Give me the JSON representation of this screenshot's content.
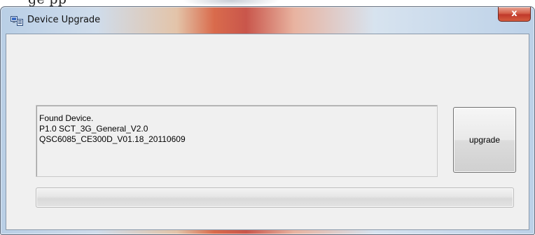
{
  "partial_top_text": "ge                                    pp",
  "window": {
    "title": "Device Upgrade",
    "close_label": "x"
  },
  "device_info": {
    "lines": [
      "Found Device.",
      "P1.0 SCT_3G_General_V2.0",
      "QSC6085_CE300D_V01.18_20110609"
    ]
  },
  "upgrade_button": {
    "label": "upgrade"
  },
  "progress": {
    "value": 0
  },
  "colors": {
    "client_bg": "#f0f0f0",
    "close_red": "#c0392b",
    "progress_fill": "#37c437"
  },
  "icons": {
    "app": "device-upgrade-app-icon",
    "close": "close-icon"
  }
}
